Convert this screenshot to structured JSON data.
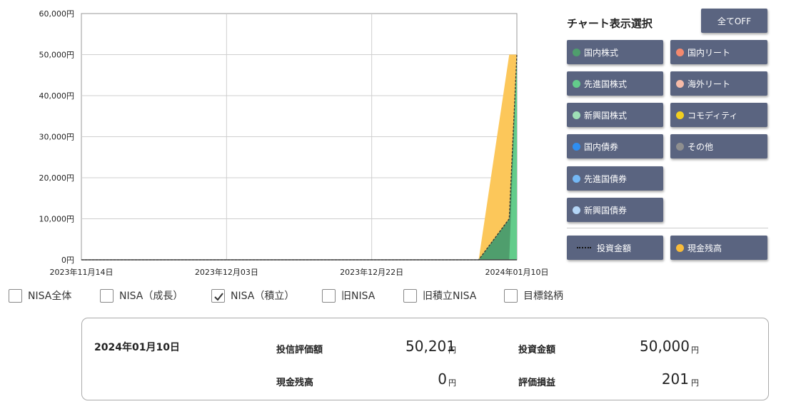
{
  "chart_data": {
    "type": "area",
    "x_tick_labels": [
      "2023年11月14日",
      "2023年12月03日",
      "2023年12月22日",
      "2024年01月10日"
    ],
    "x_tick_positions": [
      0,
      19,
      38,
      57
    ],
    "xlim": [
      0,
      57
    ],
    "y_tick_labels": [
      "0円",
      "10,000円",
      "20,000円",
      "30,000円",
      "40,000円",
      "50,000円",
      "60,000円"
    ],
    "ylim": [
      0,
      60000
    ],
    "grid": true,
    "series": [
      {
        "name": "現金残高",
        "color": "#fcc75a",
        "points": [
          [
            0,
            0
          ],
          [
            52,
            0
          ],
          [
            56,
            50000
          ],
          [
            57,
            50000
          ]
        ]
      },
      {
        "name": "国内株式",
        "color": "#4f9e6d",
        "points": [
          [
            0,
            0
          ],
          [
            52,
            0
          ],
          [
            56,
            10000
          ],
          [
            57,
            50000
          ]
        ]
      },
      {
        "name": "先進国株式",
        "color": "#63cc8b",
        "points": [
          [
            0,
            0
          ],
          [
            56,
            0
          ],
          [
            57,
            50000
          ]
        ]
      },
      {
        "name": "投資金額",
        "color": "#333333",
        "style": "dotted",
        "points": [
          [
            0,
            0
          ],
          [
            52,
            0
          ],
          [
            56,
            10000
          ],
          [
            57,
            50000
          ]
        ]
      }
    ]
  },
  "panel": {
    "title": "チャート表示選択",
    "all_off_label": "全てOFF",
    "buttons": [
      {
        "label": "国内株式",
        "color": "#4f9e6d"
      },
      {
        "label": "国内リート",
        "color": "#f4896e"
      },
      {
        "label": "先進国株式",
        "color": "#63cc8b"
      },
      {
        "label": "海外リート",
        "color": "#f7bba8"
      },
      {
        "label": "新興国株式",
        "color": "#9ee0b6"
      },
      {
        "label": "コモディティ",
        "color": "#f2cf1f"
      },
      {
        "label": "国内債券",
        "color": "#2f8ef0"
      },
      {
        "label": "その他",
        "color": "#8f8f8f"
      },
      {
        "label": "先進国債券",
        "color": "#74b8f5"
      },
      {
        "label": "新興国債券",
        "color": "#b4d6f7"
      }
    ],
    "invest_label": "投資金額",
    "cash_label": "現金残高",
    "cash_color": "#f9bc3a"
  },
  "checks": [
    {
      "label": "NISA全体",
      "checked": false
    },
    {
      "label": "NISA（成長）",
      "checked": false
    },
    {
      "label": "NISA（積立）",
      "checked": true
    },
    {
      "label": "旧NISA",
      "checked": false
    },
    {
      "label": "旧積立NISA",
      "checked": false
    },
    {
      "label": "目標銘柄",
      "checked": false
    }
  ],
  "summary": {
    "date": "2024年01月10日",
    "fund_value_label": "投信評価額",
    "fund_value": "50,201",
    "invest_label": "投資金額",
    "invest_value": "50,000",
    "cash_label": "現金残高",
    "cash_value": "0",
    "pl_label": "評価損益",
    "pl_value": "201",
    "unit": "円"
  }
}
